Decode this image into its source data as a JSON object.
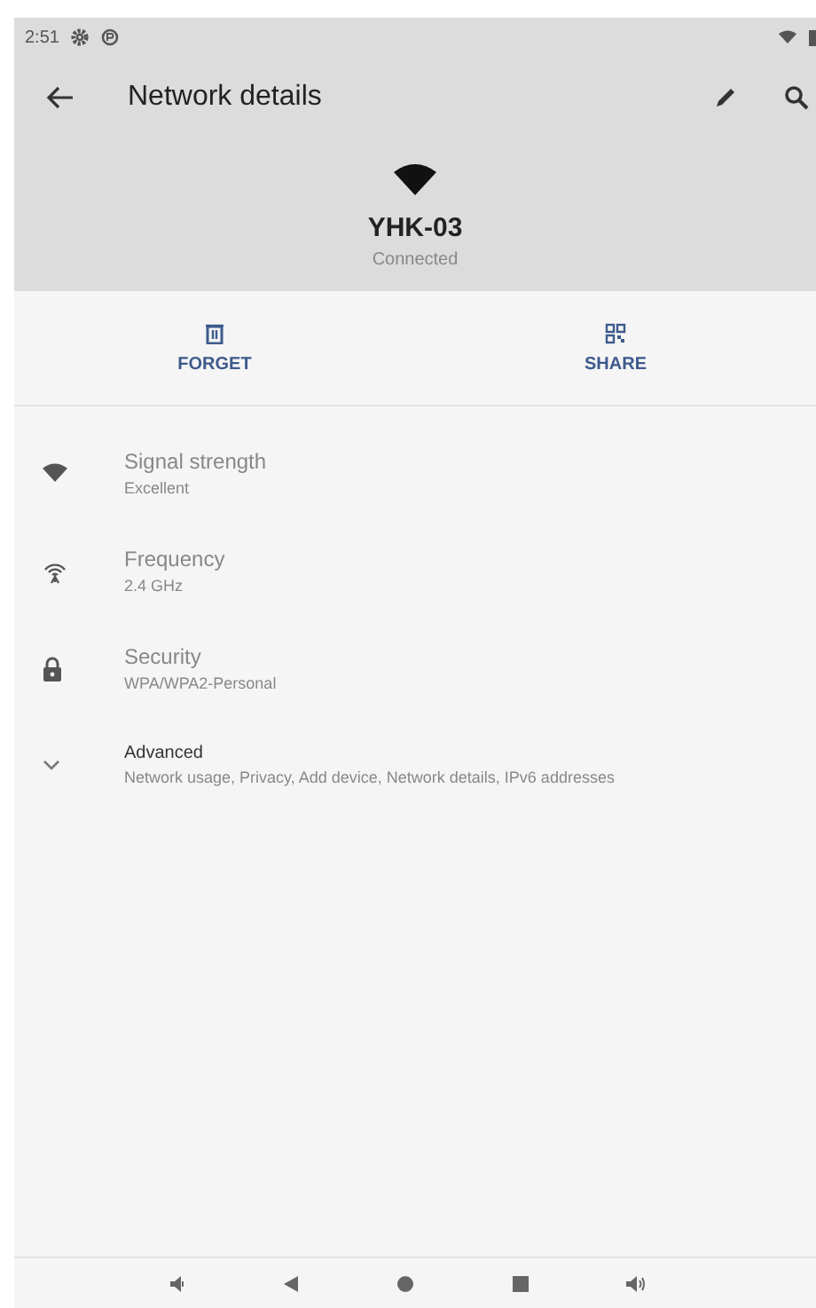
{
  "status_bar": {
    "time": "2:51"
  },
  "toolbar": {
    "title": "Network details"
  },
  "network": {
    "name": "YHK-03",
    "status": "Connected"
  },
  "actions": [
    {
      "label": "FORGET"
    },
    {
      "label": "SHARE"
    }
  ],
  "details": [
    {
      "kind": "info",
      "title": "Signal strength",
      "value": "Excellent"
    },
    {
      "kind": "info",
      "title": "Frequency",
      "value": "2.4 GHz"
    },
    {
      "kind": "info",
      "title": "Security",
      "value": "WPA/WPA2-Personal"
    },
    {
      "kind": "expandable",
      "expanded": false,
      "title": "Advanced",
      "value": "Network usage, Privacy, Add device, Network details, IPv6 addresses"
    }
  ]
}
